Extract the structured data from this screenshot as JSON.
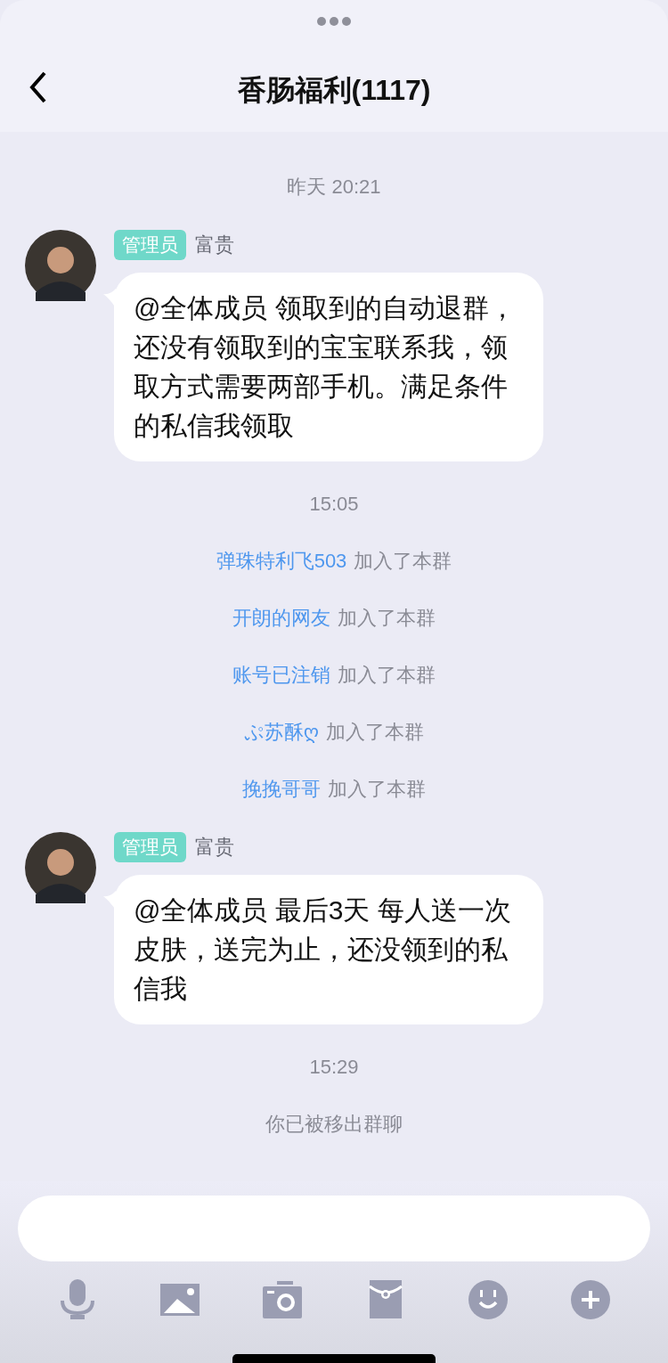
{
  "header": {
    "title": "香肠福利(1117)"
  },
  "messages": [
    {
      "kind": "time",
      "text": "昨天 20:21"
    },
    {
      "kind": "message",
      "role": "管理员",
      "sender": "富贵",
      "text": "@全体成员 领取到的自动退群，还没有领取到的宝宝联系我，领取方式需要两部手机。满足条件的私信我领取"
    },
    {
      "kind": "time",
      "text": "15:05"
    },
    {
      "kind": "join",
      "user": "弹珠特利飞503",
      "text": "加入了本群"
    },
    {
      "kind": "join",
      "user": "开朗的网友",
      "text": "加入了本群"
    },
    {
      "kind": "join",
      "user": "账号已注销",
      "text": "加入了本群"
    },
    {
      "kind": "join",
      "user": "ぷ苏酥ღ",
      "text": "加入了本群"
    },
    {
      "kind": "join",
      "user": "挽挽哥哥",
      "text": "加入了本群"
    },
    {
      "kind": "message",
      "role": "管理员",
      "sender": "富贵",
      "text": "@全体成员 最后3天 每人送一次皮肤，送完为止，还没领到的私信我"
    },
    {
      "kind": "time",
      "text": "15:29"
    },
    {
      "kind": "system",
      "text": "你已被移出群聊"
    }
  ]
}
